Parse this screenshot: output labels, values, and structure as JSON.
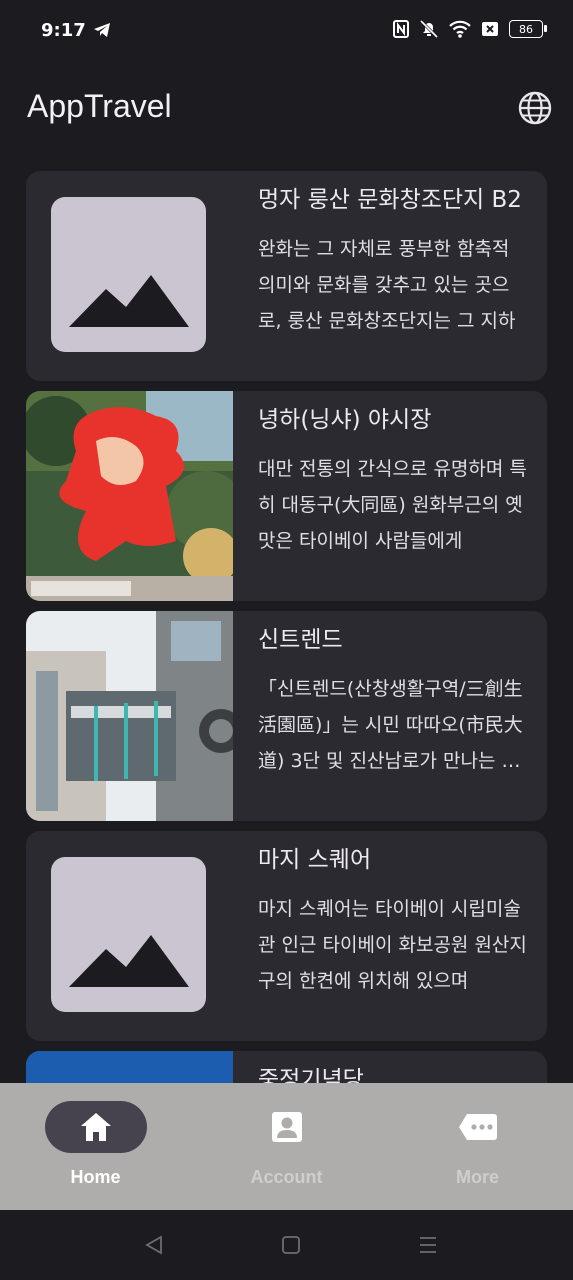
{
  "status": {
    "time": "9:17",
    "battery": "86",
    "icons": [
      "telegram-icon",
      "nfc-icon",
      "mute-icon",
      "wifi-icon",
      "sim-off-icon",
      "battery-icon"
    ]
  },
  "app": {
    "title": "AppTravel",
    "action_icon": "globe-icon"
  },
  "places": [
    {
      "title": "멍자 룽산 문화창조단지 B2",
      "desc": "완화는 그 자체로 풍부한 함축적 의미와 문화를 갖추고 있는 곳으로, 룽산 문화창조단지는 그 지하",
      "thumb": "placeholder"
    },
    {
      "title": "녕하(닝샤) 야시장",
      "desc": "대만 전통의 간식으로 유명하며 특히 대동구(大同區) 원화부근의 옛맛은 타이베이 사람들에게",
      "thumb": "photo"
    },
    {
      "title": "신트렌드",
      "desc": "「신트렌드(산창생활구역/三創生活園區)」는 시민 따따오(市民大道) 3단 및 진산남로가 만나는 곳에",
      "thumb": "photo"
    },
    {
      "title": "마지 스퀘어",
      "desc": "마지 스퀘어는 타이베이 시립미술관 인근 타이베이 화보공원 원산지구의 한켠에 위치해 있으며",
      "thumb": "placeholder"
    },
    {
      "title": "중정기념당",
      "desc": "",
      "thumb": "photo"
    }
  ],
  "nav": {
    "items": [
      {
        "label": "Home",
        "icon": "home-icon",
        "active": true
      },
      {
        "label": "Account",
        "icon": "account-icon",
        "active": false
      },
      {
        "label": "More",
        "icon": "more-icon",
        "active": false
      }
    ]
  },
  "colors": {
    "background": "#1c1b20",
    "card": "#2b2a30",
    "placeholder": "#cbc4d1",
    "nav_bg": "#aeadab",
    "nav_active_pill": "#46434f"
  }
}
